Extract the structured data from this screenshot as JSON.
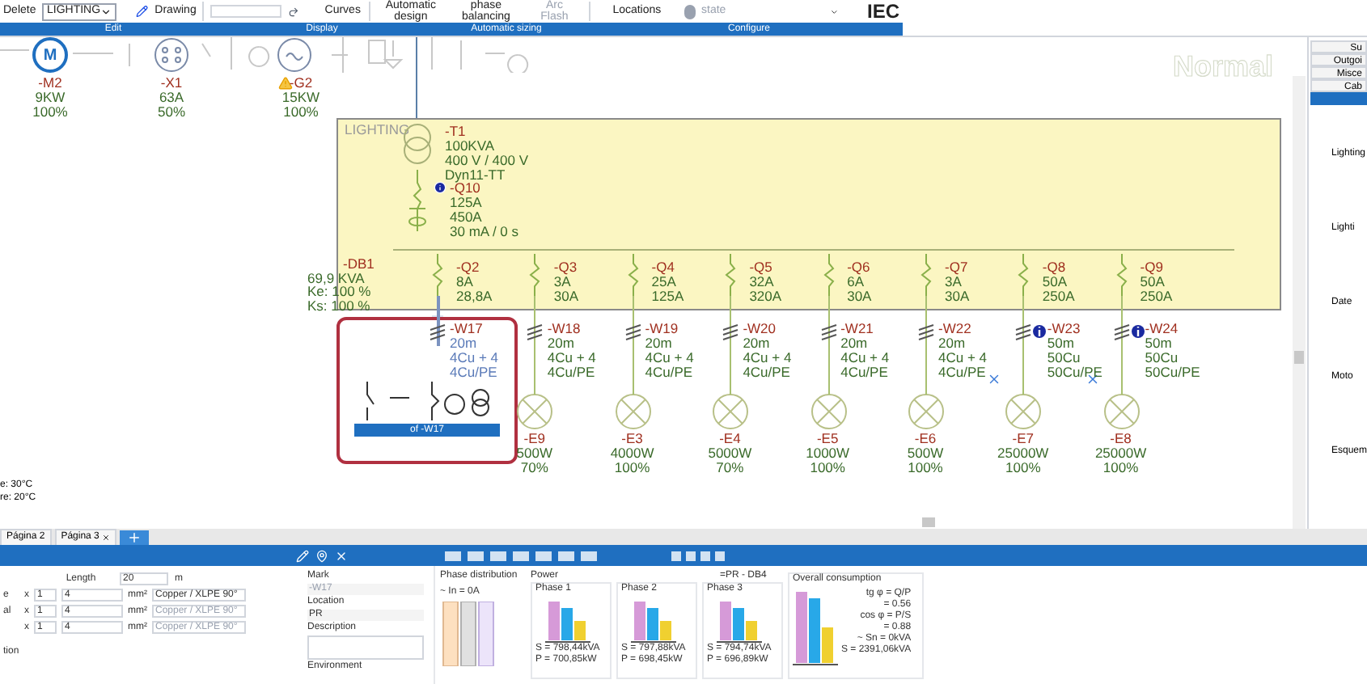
{
  "ribbon": {
    "delete_label": "Delete",
    "layer_select": "LIGHTING",
    "drawing_label": "Drawing",
    "curves_label": "Curves",
    "buttons": [
      {
        "lines": [
          "Automatic",
          "design"
        ],
        "disabled": false
      },
      {
        "lines": [
          "phase",
          "balancing"
        ],
        "disabled": false
      },
      {
        "lines": [
          "Arc Flash"
        ],
        "disabled": true
      }
    ],
    "locations_label": "Locations",
    "state_label": "state",
    "standard": "IEC",
    "groups": [
      "Edit",
      "Display",
      "Automatic sizing",
      "Configure"
    ]
  },
  "canvas": {
    "mode_label": "Normal",
    "top_loads": [
      {
        "kind": "motor",
        "mark": "-M2",
        "power": "9KW",
        "percent": "100%",
        "warning": false,
        "symbol": "M"
      },
      {
        "kind": "socket",
        "mark": "-X1",
        "power": "63A",
        "percent": "50%",
        "warning": false
      },
      {
        "kind": "generator",
        "mark": "-G2",
        "power": "15KW",
        "percent": "100%",
        "warning": true
      }
    ],
    "notes": [
      "e: 30°C",
      "re: 20°C"
    ],
    "board": {
      "title": "LIGHTING",
      "transformer": {
        "mark": "-T1",
        "lines": [
          "100KVA",
          "400 V / 400 V",
          "Dyn11-TT"
        ]
      },
      "main_breaker": {
        "mark": "-Q10",
        "info": true,
        "lines": [
          "125A",
          "450A",
          "30 mA / 0 s"
        ]
      },
      "distribution": {
        "mark": "-DB1",
        "lines": [
          "69,9 KVA",
          "Ke: 100 %",
          "Ks: 100 %"
        ]
      }
    },
    "feeders": [
      {
        "breaker": {
          "mark": "-Q2",
          "lines": [
            "8A",
            "28,8A"
          ]
        },
        "cable": {
          "mark": "-W17",
          "info": false,
          "lines": [
            "20m",
            "4Cu + 4",
            "4Cu/PE"
          ]
        },
        "selected": true
      },
      {
        "breaker": {
          "mark": "-Q3",
          "lines": [
            "3A",
            "30A"
          ]
        },
        "cable": {
          "mark": "-W18",
          "info": false,
          "lines": [
            "20m",
            "4Cu + 4",
            "4Cu/PE"
          ]
        },
        "load": {
          "mark": "-E9",
          "power": "500W",
          "percent": "70%",
          "crossed": false
        },
        "selected": false
      },
      {
        "breaker": {
          "mark": "-Q4",
          "lines": [
            "25A",
            "125A"
          ]
        },
        "cable": {
          "mark": "-W19",
          "info": false,
          "lines": [
            "20m",
            "4Cu + 4",
            "4Cu/PE"
          ]
        },
        "load": {
          "mark": "-E3",
          "power": "4000W",
          "percent": "100%",
          "crossed": false
        },
        "selected": false
      },
      {
        "breaker": {
          "mark": "-Q5",
          "lines": [
            "32A",
            "320A"
          ]
        },
        "cable": {
          "mark": "-W20",
          "info": false,
          "lines": [
            "20m",
            "4Cu + 4",
            "4Cu/PE"
          ]
        },
        "load": {
          "mark": "-E4",
          "power": "5000W",
          "percent": "70%",
          "crossed": false
        },
        "selected": false
      },
      {
        "breaker": {
          "mark": "-Q6",
          "lines": [
            "6A",
            "30A"
          ]
        },
        "cable": {
          "mark": "-W21",
          "info": false,
          "lines": [
            "20m",
            "4Cu + 4",
            "4Cu/PE"
          ]
        },
        "load": {
          "mark": "-E5",
          "power": "1000W",
          "percent": "100%",
          "crossed": false
        },
        "selected": false
      },
      {
        "breaker": {
          "mark": "-Q7",
          "lines": [
            "3A",
            "30A"
          ]
        },
        "cable": {
          "mark": "-W22",
          "info": false,
          "lines": [
            "20m",
            "4Cu + 4",
            "4Cu/PE"
          ]
        },
        "load": {
          "mark": "-E6",
          "power": "500W",
          "percent": "100%",
          "crossed": false
        },
        "selected": false
      },
      {
        "breaker": {
          "mark": "-Q8",
          "lines": [
            "50A",
            "250A"
          ]
        },
        "cable": {
          "mark": "-W23",
          "info": true,
          "lines": [
            "50m",
            "50Cu",
            "50Cu/PE"
          ]
        },
        "load": {
          "mark": "-E7",
          "power": "25000W",
          "percent": "100%",
          "crossed": true
        },
        "selected": false
      },
      {
        "breaker": {
          "mark": "-Q9",
          "lines": [
            "50A",
            "250A"
          ]
        },
        "cable": {
          "mark": "-W24",
          "info": true,
          "lines": [
            "50m",
            "50Cu",
            "50Cu/PE"
          ]
        },
        "load": {
          "mark": "-E8",
          "power": "25000W",
          "percent": "100%",
          "crossed": true
        },
        "selected": false
      }
    ],
    "popup": {
      "caption": "of -W17"
    }
  },
  "side_panel": {
    "tabs": [
      {
        "label": "Su",
        "selected": false
      },
      {
        "label": "Outgoi",
        "selected": false
      },
      {
        "label": "Misce",
        "selected": false
      },
      {
        "label": "Cab",
        "selected": false
      },
      {
        "selected": true
      }
    ],
    "tiles": [
      "Lighting",
      "Lighti",
      "Date",
      "Moto",
      "Esquem"
    ]
  },
  "page_tabs": [
    {
      "label": "Página 2",
      "closable": false
    },
    {
      "label": "Página 3",
      "closable": true
    }
  ],
  "cable_form": {
    "length_label": "Length",
    "length": "20",
    "length_unit": "m",
    "rows": [
      {
        "label": "e",
        "times": "x",
        "count": "1",
        "section": "4",
        "unit": "mm²",
        "material": "Copper / XLPE 90°",
        "disabled": false
      },
      {
        "label": "al",
        "times": "x",
        "count": "1",
        "section": "4",
        "unit": "mm²",
        "material": "Copper / XLPE 90°",
        "disabled": true
      },
      {
        "times": "x",
        "count": "1",
        "section": "4",
        "unit": "mm²",
        "material": "Copper / XLPE 90°",
        "disabled": true
      }
    ],
    "section_label": "tion"
  },
  "properties": {
    "mark_label": "Mark",
    "mark": "-W17",
    "location_label": "Location",
    "location": "PR",
    "description_label": "Description",
    "environment_label": "Environment"
  },
  "phase_distribution": {
    "title": "Phase distribution",
    "legend": "~ In = 0A"
  },
  "power": {
    "title": "Power",
    "board": "=PR - DB4",
    "phases": [
      {
        "title": "Phase 1",
        "s": "S = 798,44kVA",
        "p": "P = 700,85kW"
      },
      {
        "title": "Phase 2",
        "s": "S = 797,88kVA",
        "p": "P = 698,45kW"
      },
      {
        "title": "Phase 3",
        "s": "S = 794,74kVA",
        "p": "P = 696,89kW"
      }
    ]
  },
  "overall": {
    "title": "Overall consumption",
    "lines": [
      "tg φ = Q/P",
      "= 0.56",
      "cos φ = P/S",
      "= 0.88",
      "~ Sn = 0kVA"
    ],
    "s": "S = 2391,06kVA"
  }
}
